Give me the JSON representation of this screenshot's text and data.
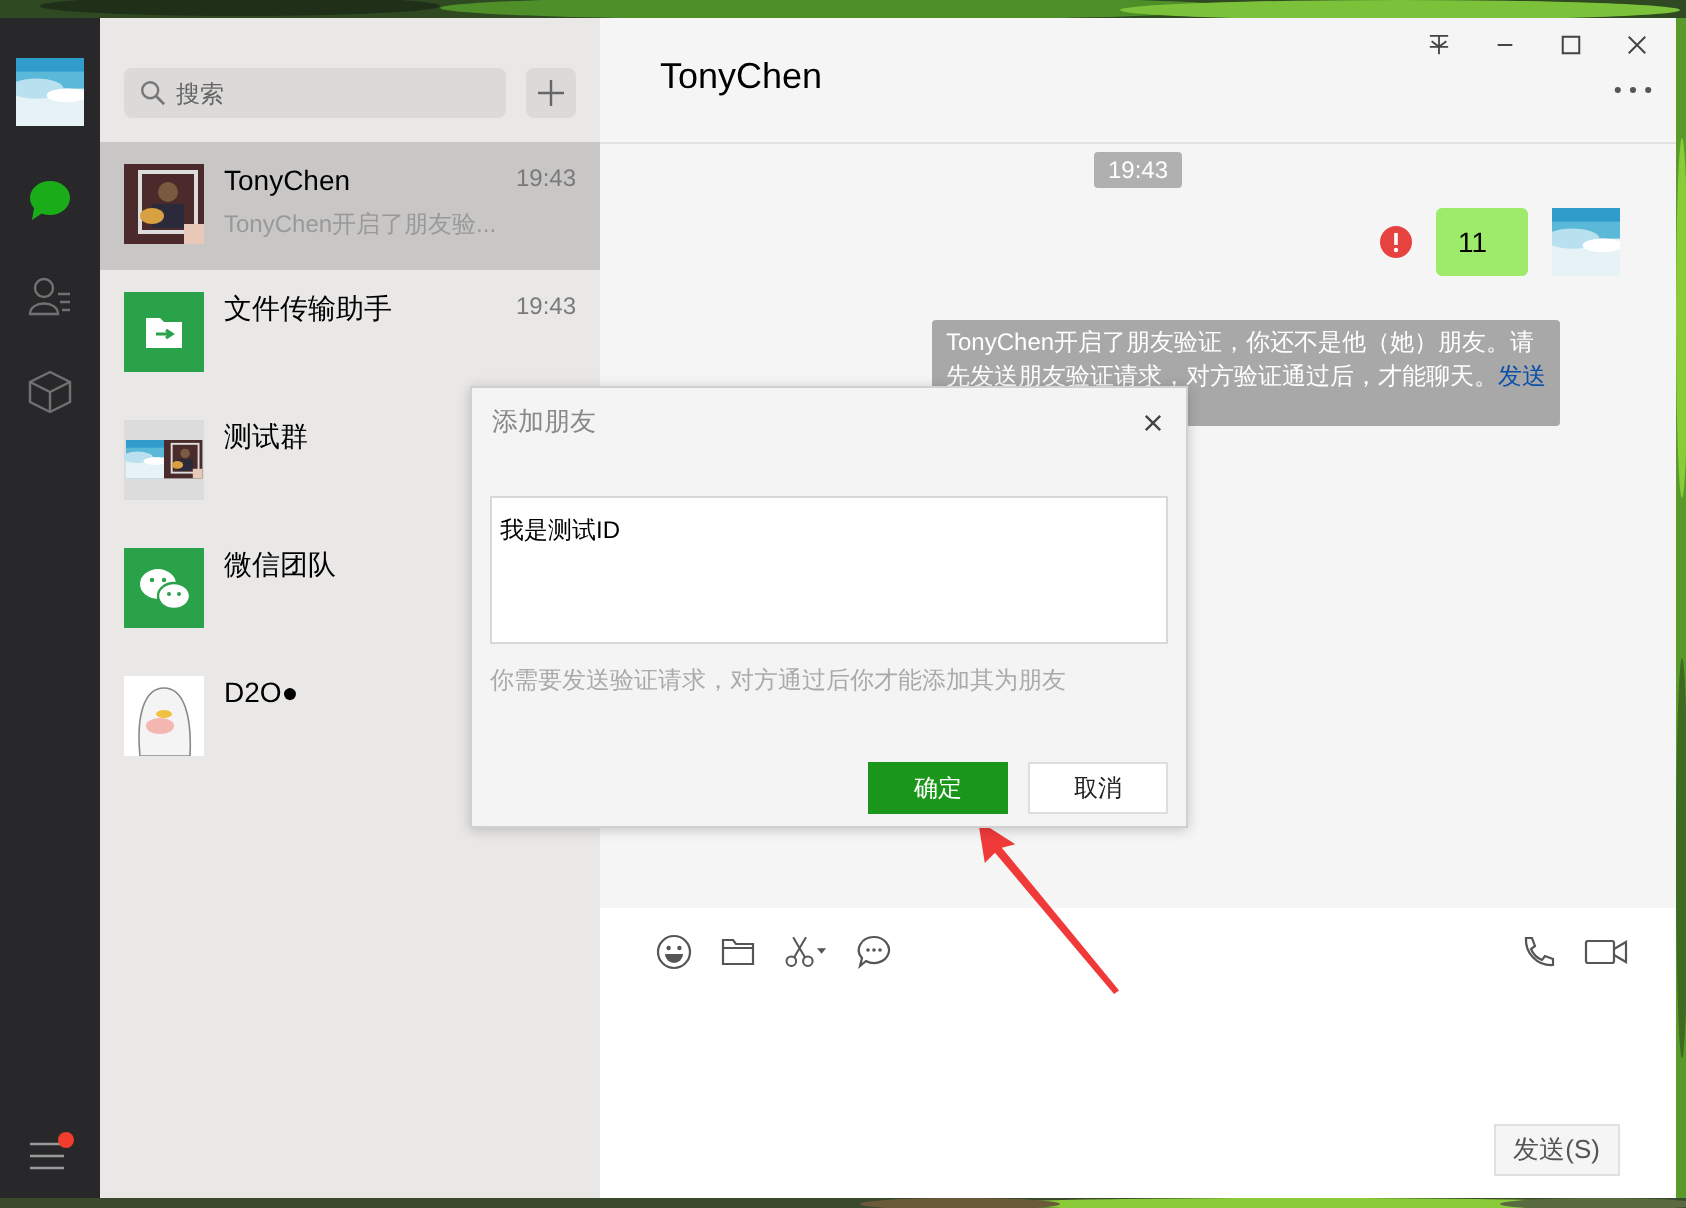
{
  "sidebar": {
    "nav_items": [
      {
        "kind": "chat",
        "selected": true
      },
      {
        "kind": "contacts",
        "selected": false
      },
      {
        "kind": "favorites",
        "selected": false
      }
    ],
    "menu": {
      "has_notification": true
    }
  },
  "search": {
    "placeholder": "搜索"
  },
  "conversations": [
    {
      "name": "TonyChen",
      "preview": "TonyChen开启了朋友验...",
      "time": "19:43",
      "selected": true
    },
    {
      "name": "文件传输助手",
      "time": "19:43",
      "kind": "file",
      "selected": false
    },
    {
      "name": "测试群",
      "kind": "group",
      "selected": false
    },
    {
      "name": "微信团队",
      "kind": "wechat",
      "selected": false
    },
    {
      "name": "D2O●",
      "kind": "sticker",
      "selected": false
    }
  ],
  "chat": {
    "title": "TonyChen",
    "timestamp": "19:43",
    "messages": [
      {
        "kind": "outgoing",
        "text": "11",
        "failed": true
      },
      {
        "kind": "system",
        "text": "TonyChen开启了朋友验证，你还不是他（她）朋友。请先发送朋友验证请求，对方验证通过后，才能聊天。",
        "link": "发送"
      }
    ],
    "send_button": "发送(S)"
  },
  "dialog": {
    "title": "添加朋友",
    "value": "我是测试ID",
    "hint": "你需要发送验证请求，对方通过后你才能添加其为朋友",
    "buttons": [
      {
        "label": "确定",
        "primary": true
      },
      {
        "label": "取消",
        "primary": false
      }
    ]
  }
}
